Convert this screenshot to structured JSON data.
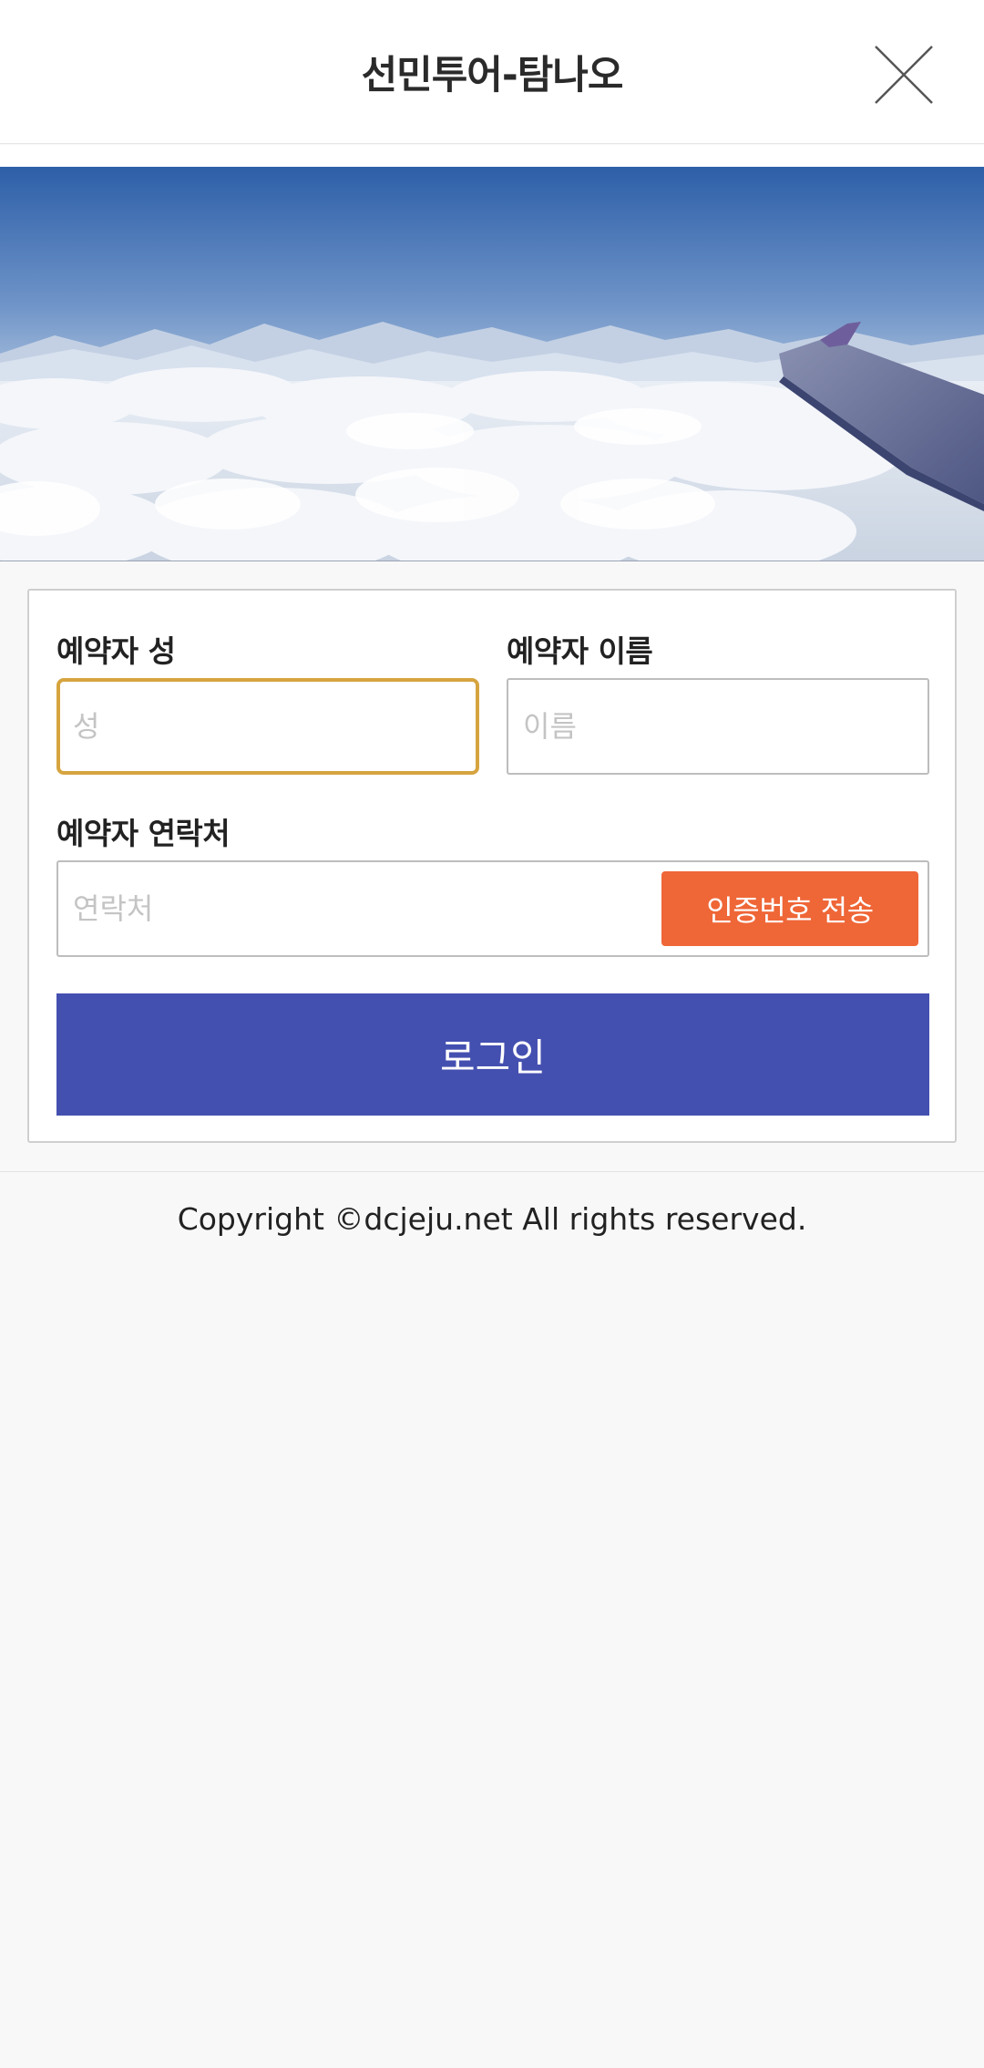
{
  "header": {
    "title": "선민투어-탐나오",
    "close_icon": "close-icon"
  },
  "hero": {
    "image_description": "airplane-wing-over-clouds-image"
  },
  "form": {
    "last_name": {
      "label": "예약자 성",
      "placeholder": "성",
      "value": ""
    },
    "first_name": {
      "label": "예약자 이름",
      "placeholder": "이름",
      "value": ""
    },
    "phone": {
      "label": "예약자 연락처",
      "placeholder": "연락처",
      "value": ""
    },
    "verify_button_label": "인증번호 전송",
    "login_button_label": "로그인"
  },
  "footer": {
    "copyright": "Copyright ©dcjeju.net All rights reserved."
  },
  "colors": {
    "accent_blue": "#4450b0",
    "accent_orange": "#ef6637",
    "focus_border": "#d6a43f",
    "background": "#f8f8f8"
  }
}
